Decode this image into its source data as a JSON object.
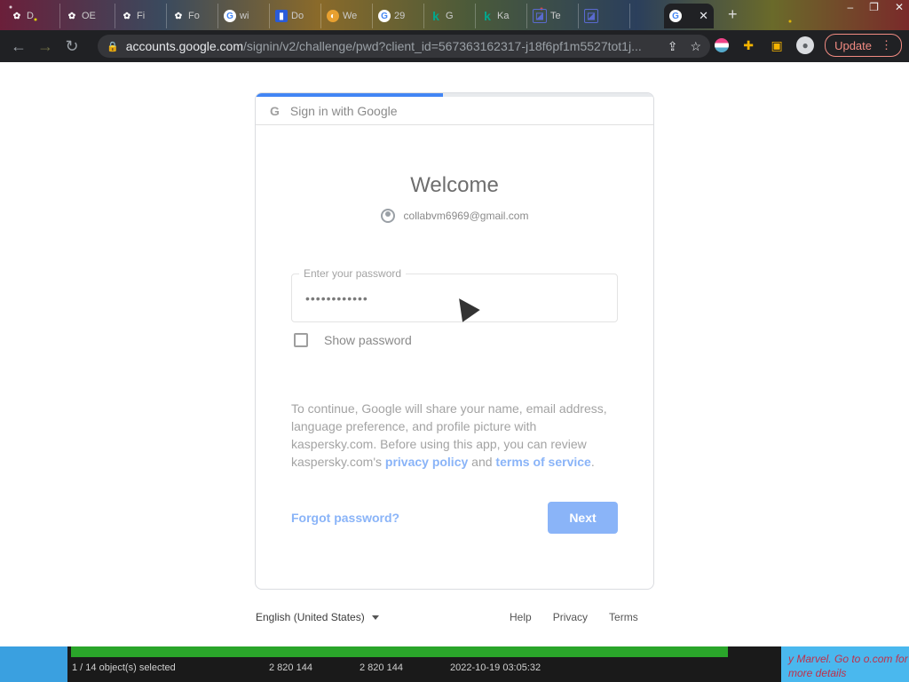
{
  "tabs": [
    {
      "label": "D",
      "favicon": "flower-icon"
    },
    {
      "label": "OE",
      "favicon": "flower-icon"
    },
    {
      "label": "Fi",
      "favicon": "flower-icon"
    },
    {
      "label": "Fo",
      "favicon": "flower-icon"
    },
    {
      "label": "wi",
      "favicon": "google-icon"
    },
    {
      "label": "Do",
      "favicon": "doc-icon"
    },
    {
      "label": "We",
      "favicon": "web-icon"
    },
    {
      "label": "29",
      "favicon": "google-icon"
    },
    {
      "label": "G",
      "favicon": "kaspersky-icon"
    },
    {
      "label": "Ka",
      "favicon": "kaspersky-icon"
    },
    {
      "label": "Te",
      "favicon": "square-icon"
    },
    {
      "label": "",
      "favicon": "square-icon"
    },
    {
      "label": "",
      "favicon": "google-icon",
      "active": true
    }
  ],
  "browser": {
    "url_host": "accounts.google.com",
    "url_path": "/signin/v2/challenge/pwd?client_id=567363162317-j18f6pf1m5527tot1j...",
    "update_label": "Update"
  },
  "signin": {
    "header": "Sign in with Google",
    "welcome": "Welcome",
    "email": "collabvm6969@gmail.com",
    "password_label": "Enter your password",
    "password_value": "••••••••••••",
    "show_password": "Show password",
    "consent_1": "To continue, Google will share your name, email address, language preference, and profile picture with kaspersky.com. Before using this app, you can review kaspersky.com's ",
    "privacy_link": "privacy policy",
    "consent_and": " and ",
    "terms_link": "terms of service",
    "consent_end": ".",
    "forgot": "Forgot password?",
    "next": "Next"
  },
  "footer": {
    "language": "English (United States)",
    "help": "Help",
    "privacy": "Privacy",
    "terms": "Terms"
  },
  "taskbar": {
    "selected": "1 / 14 object(s) selected",
    "size1": "2 820 144",
    "size2": "2 820 144",
    "date": "2022-10-19 03:05:32",
    "ad": "y Marvel. Go to o.com for more details"
  },
  "colors": {
    "accent": "#8ab4f8",
    "progress": "#4285f4",
    "toolbar": "#202124"
  }
}
